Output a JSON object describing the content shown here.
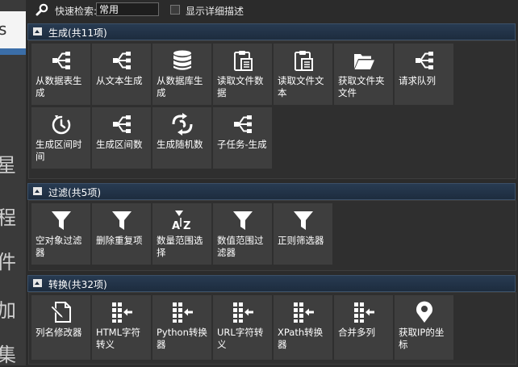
{
  "toolbar": {
    "search_label": "快速检索:",
    "search_value": "常用",
    "detail_checkbox_label": "显示详细描述",
    "detail_checked": false
  },
  "background": {
    "partial_text": "s",
    "side_glyphs": [
      "星",
      "程",
      "件",
      "加",
      "集"
    ]
  },
  "sections": [
    {
      "title": "生成(共11项)",
      "items": [
        {
          "label": "从数据表生成",
          "icon": "share-tree-icon"
        },
        {
          "label": "从文本生成",
          "icon": "share-tree-icon"
        },
        {
          "label": "从数据库生成",
          "icon": "database-icon"
        },
        {
          "label": "读取文件数据",
          "icon": "clipboard-icon"
        },
        {
          "label": "读取文件文本",
          "icon": "clipboard-icon"
        },
        {
          "label": "获取文件夹文件",
          "icon": "folder-open-icon"
        },
        {
          "label": "请求队列",
          "icon": "share-tree-icon"
        },
        {
          "label": "生成区间时间",
          "icon": "timer-icon"
        },
        {
          "label": "生成区间数",
          "icon": "share-tree-icon"
        },
        {
          "label": "生成随机数",
          "icon": "random-icon"
        },
        {
          "label": "子任务-生成",
          "icon": "share-tree-icon"
        }
      ]
    },
    {
      "title": "过滤(共5项)",
      "items": [
        {
          "label": "空对象过滤器",
          "icon": "filter-icon"
        },
        {
          "label": "删除重复项",
          "icon": "filter-icon"
        },
        {
          "label": "数量范围选择",
          "icon": "sort-az-icon"
        },
        {
          "label": "数值范围过滤器",
          "icon": "filter-icon"
        },
        {
          "label": "正则筛选器",
          "icon": "filter-icon"
        }
      ]
    },
    {
      "title": "转换(共32项)",
      "items": [
        {
          "label": "列名修改器",
          "icon": "edit-document-icon"
        },
        {
          "label": "HTML字符转义",
          "icon": "grid-arrow-icon"
        },
        {
          "label": "Python转换器",
          "icon": "grid-arrow-icon"
        },
        {
          "label": "URL字符转义",
          "icon": "grid-arrow-icon"
        },
        {
          "label": "XPath转换器",
          "icon": "grid-arrow-icon"
        },
        {
          "label": "合并多列",
          "icon": "grid-arrow-icon"
        },
        {
          "label": "获取IP的坐标",
          "icon": "map-pin-icon"
        }
      ]
    }
  ]
}
